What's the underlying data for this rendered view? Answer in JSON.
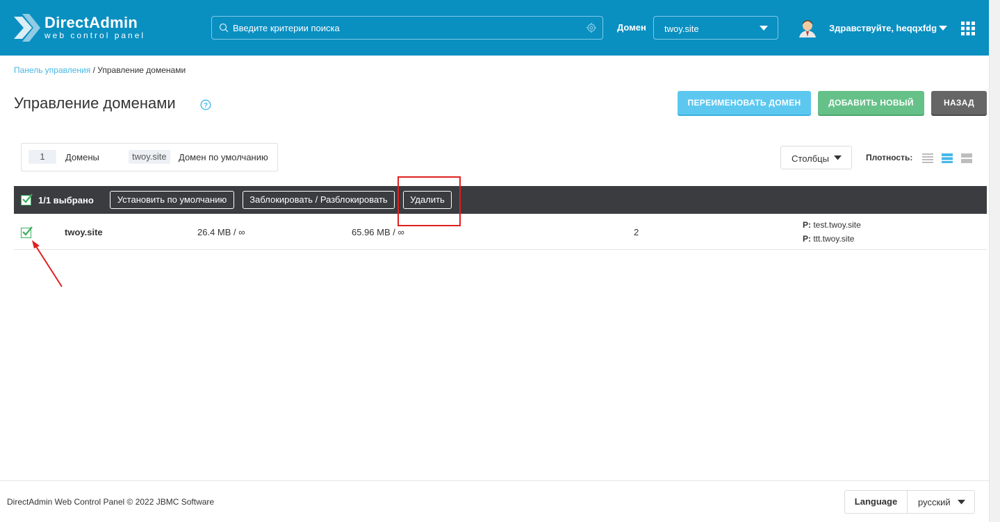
{
  "header": {
    "logo_title": "DirectAdmin",
    "logo_subtitle": "web control panel",
    "search_placeholder": "Введите критерии поиска",
    "domain_label": "Домен",
    "domain_value": "twoy.site",
    "greeting": "Здравствуйте, heqqxfdg"
  },
  "breadcrumb": {
    "link": "Панель управления",
    "separator": " / ",
    "current": "Управление доменами"
  },
  "page": {
    "title": "Управление доменами",
    "buttons": {
      "rename": "ПЕРЕИМЕНОВАТЬ ДОМЕН",
      "add": "ДОБАВИТЬ НОВЫЙ",
      "back": "НАЗАД"
    }
  },
  "stats": {
    "count": "1",
    "domains_label": "Домены",
    "default_domain": "twoy.site",
    "default_label": "Домен по умолчанию"
  },
  "toolbar": {
    "columns_label": "Столбцы",
    "density_label": "Плотность:"
  },
  "selection_bar": {
    "count": "1/1 выбрано",
    "set_default": "Установить по умолчанию",
    "block_unblock": "Заблокировать / Разблокировать",
    "delete": "Удалить"
  },
  "domains": [
    {
      "name": "twoy.site",
      "disk": "26.4 MB / ∞",
      "bandwidth": "65.96 MB / ∞",
      "count": "2",
      "subdomain_prefix": "P:",
      "subdomains": [
        "test.twoy.site",
        "ttt.twoy.site"
      ]
    }
  ],
  "footer": {
    "copyright": "DirectAdmin Web Control Panel © 2022 JBMC Software",
    "language_label": "Language",
    "language_value": "русский"
  },
  "colors": {
    "header_bg": "#0a8fc1",
    "rename_button": "#5cc8f0",
    "add_button": "#66c188",
    "back_button": "#666666",
    "selection_bar": "#3a3c40",
    "highlight": "#e01f1f",
    "check_green": "#3aae5c"
  }
}
